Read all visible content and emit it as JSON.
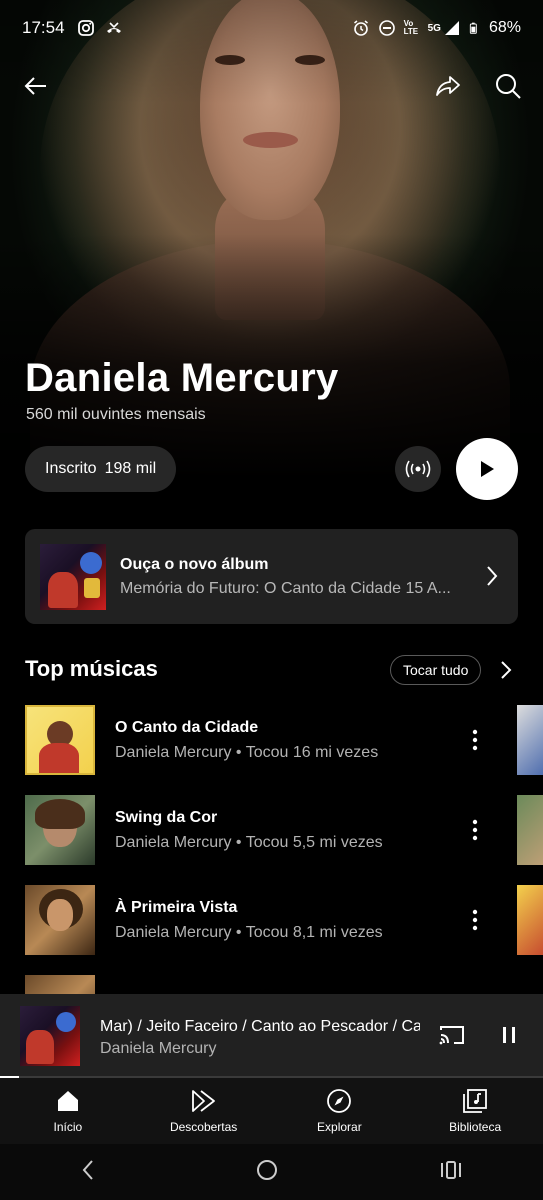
{
  "status_bar": {
    "time": "17:54",
    "network": "5G",
    "volte": "Vo LTE",
    "battery": "68%"
  },
  "artist": {
    "name": "Daniela Mercury",
    "listeners": "560 mil ouvintes mensais"
  },
  "actions": {
    "subscribe_label": "Inscrito",
    "subscribe_count": "198 mil"
  },
  "new_album": {
    "heading": "Ouça o novo álbum",
    "title": "Memória do Futuro: O Canto da Cidade 15 A..."
  },
  "top_songs": {
    "heading": "Top músicas",
    "play_all": "Tocar tudo",
    "items": [
      {
        "title": "O Canto da Cidade",
        "meta": "Daniela Mercury • Tocou 16 mi vezes"
      },
      {
        "title": "Swing da Cor",
        "meta": "Daniela Mercury • Tocou 5,5 mi vezes"
      },
      {
        "title": "À Primeira Vista",
        "meta": "Daniela Mercury • Tocou 8,1 mi vezes"
      }
    ]
  },
  "now_playing": {
    "title": "Mar) / Jeito Faceiro / Canto ao Pescador / Can",
    "artist": "Daniela Mercury",
    "progress": 0.035
  },
  "bottom_nav": {
    "items": [
      {
        "label": "Início",
        "icon": "home-icon"
      },
      {
        "label": "Descobertas",
        "icon": "explore-play-icon"
      },
      {
        "label": "Explorar",
        "icon": "compass-icon"
      },
      {
        "label": "Biblioteca",
        "icon": "library-icon"
      }
    ]
  },
  "colors": {
    "background": "#000000",
    "card": "#212121",
    "pill": "#272727",
    "secondary_text": "#b3b3b3"
  }
}
